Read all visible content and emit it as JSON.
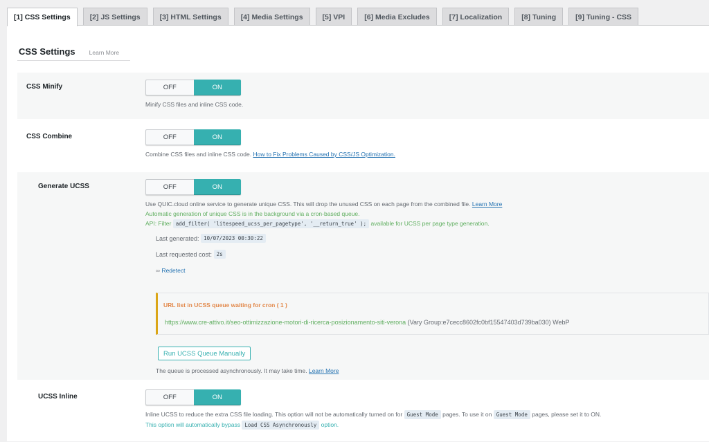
{
  "tabs": [
    {
      "label": "[1] CSS Settings",
      "active": true
    },
    {
      "label": "[2] JS Settings",
      "active": false
    },
    {
      "label": "[3] HTML Settings",
      "active": false
    },
    {
      "label": "[4] Media Settings",
      "active": false
    },
    {
      "label": "[5] VPI",
      "active": false
    },
    {
      "label": "[6] Media Excludes",
      "active": false
    },
    {
      "label": "[7] Localization",
      "active": false
    },
    {
      "label": "[8] Tuning",
      "active": false
    },
    {
      "label": "[9] Tuning - CSS",
      "active": false
    }
  ],
  "section": {
    "title": "CSS Settings",
    "learn_more": "Learn More"
  },
  "toggle_labels": {
    "off": "OFF",
    "on": "ON"
  },
  "settings": {
    "css_minify": {
      "label": "CSS Minify",
      "state": "ON",
      "desc": "Minify CSS files and inline CSS code."
    },
    "css_combine": {
      "label": "CSS Combine",
      "state": "ON",
      "desc": "Combine CSS files and inline CSS code.",
      "link": "How to Fix Problems Caused by CSS/JS Optimization."
    },
    "generate_ucss": {
      "label": "Generate UCSS",
      "state": "ON",
      "desc1": "Use QUIC.cloud online service to generate unique CSS. This will drop the unused CSS on each page from the combined file.",
      "desc1_link": "Learn More",
      "desc2": "Automatic generation of unique CSS is in the background via a cron-based queue.",
      "api_prefix": "API: Filter",
      "api_code": "add_filter( 'litespeed_ucss_per_pagetype', '__return_true' );",
      "api_suffix": "available for UCSS per page type generation.",
      "last_generated_label": "Last generated:",
      "last_generated_value": "10/07/2023 00:30:22",
      "last_cost_label": "Last requested cost:",
      "last_cost_value": "2s",
      "redetect_label": "Redetect",
      "queue_title": "URL list in UCSS queue waiting for cron ( 1 )",
      "queue_url": "https://www.cre-attivo.it/seo-ottimizzazione-motori-di-ricerca-posizionamento-siti-verona",
      "queue_url_meta": "(Vary Group:e7cecc8602fc0bf15547403d739ba030) WebP",
      "run_button": "Run UCSS Queue Manually",
      "queue_note": "The queue is processed asynchronously. It may take time.",
      "queue_note_link": "Learn More"
    },
    "ucss_inline": {
      "label": "UCSS Inline",
      "state": "ON",
      "desc_a": "Inline UCSS to reduce the extra CSS file loading. This option will not be automatically turned on for",
      "code_guest": "Guest Mode",
      "desc_b": "pages. To use it on",
      "desc_c": "pages, please set it to ON.",
      "bypass_prefix": "This option will automatically bypass",
      "bypass_code": "Load CSS Asynchronously",
      "bypass_suffix": "option."
    }
  }
}
